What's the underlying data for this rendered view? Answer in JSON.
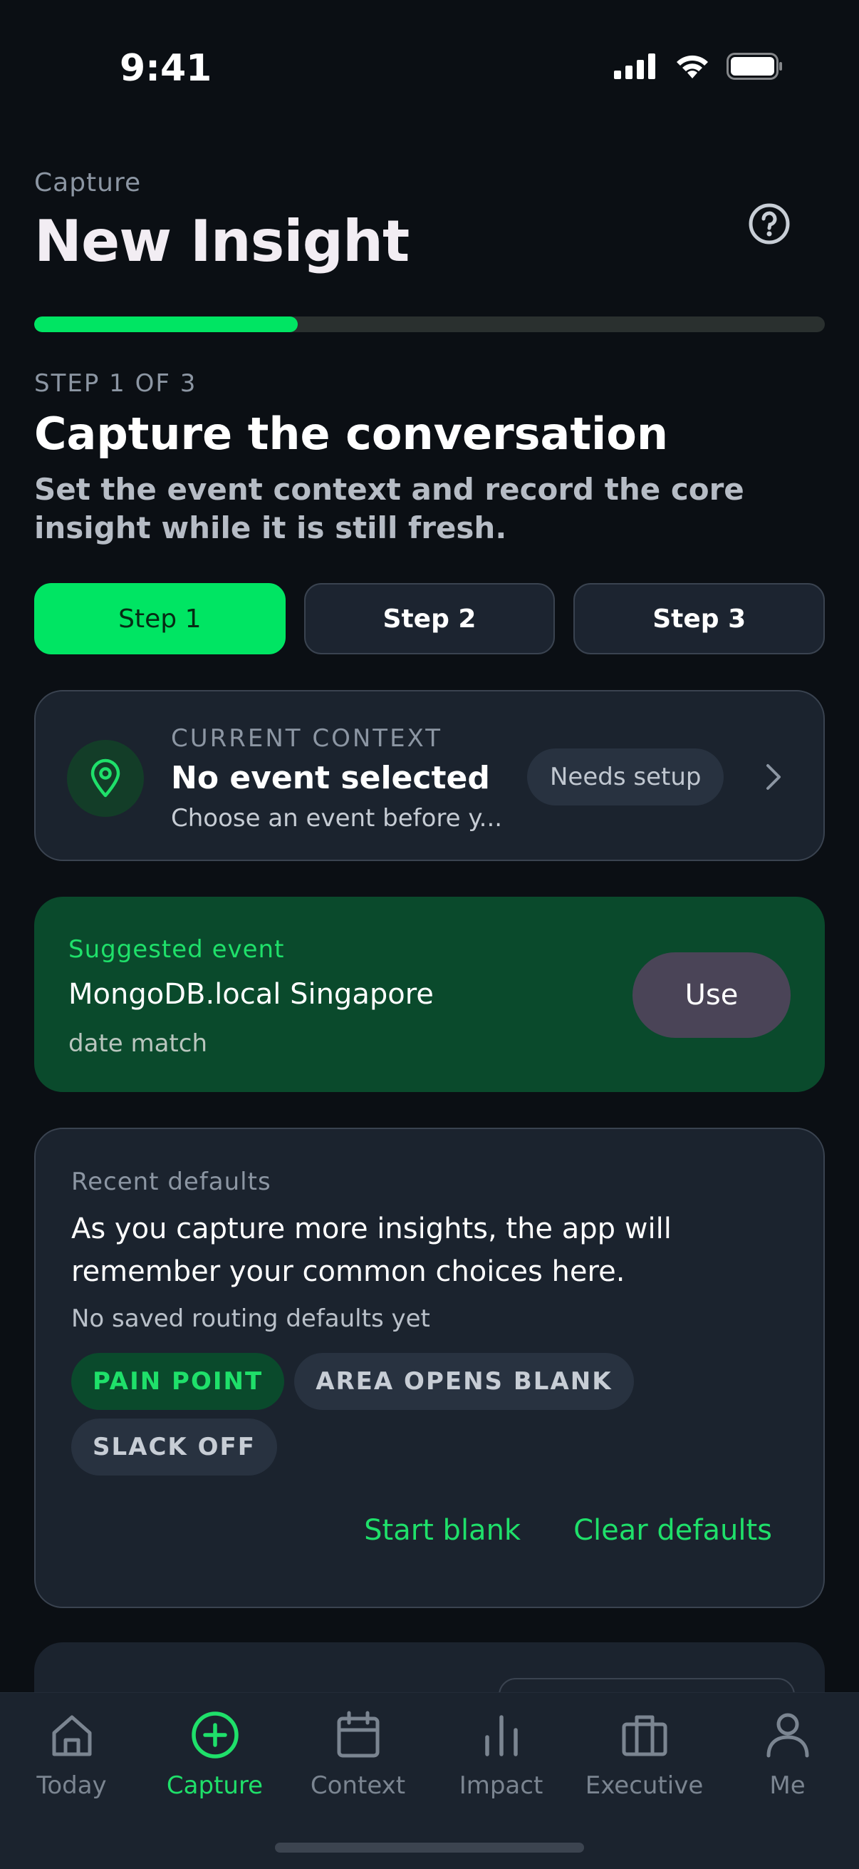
{
  "status_bar": {
    "time": "9:41"
  },
  "header": {
    "eyebrow": "Capture",
    "title": "New Insight"
  },
  "progress": {
    "fraction": 0.333
  },
  "step": {
    "meta": "STEP 1 OF 3",
    "title": "Capture the conversation",
    "description": "Set the event context and record the core insight while it is still fresh."
  },
  "tabs": [
    {
      "label": "Step 1",
      "active": true
    },
    {
      "label": "Step 2",
      "active": false
    },
    {
      "label": "Step 3",
      "active": false
    }
  ],
  "context": {
    "label": "CURRENT CONTEXT",
    "title": "No event selected",
    "subtitle": "Choose an event before y...",
    "badge": "Needs setup"
  },
  "suggested": {
    "label": "Suggested event",
    "name": "MongoDB.local Singapore",
    "meta": "date match",
    "action": "Use"
  },
  "defaults": {
    "label": "Recent defaults",
    "description": "As you capture more insights, the app will remember your common choices here.",
    "empty": "No saved routing defaults yet",
    "chips": [
      {
        "label": "PAIN POINT",
        "tone": "green"
      },
      {
        "label": "AREA OPENS BLANK",
        "tone": "neutral"
      },
      {
        "label": "SLACK OFF",
        "tone": "neutral"
      }
    ],
    "start_blank": "Start blank",
    "clear_defaults": "Clear defaults"
  },
  "tabbar": {
    "items": [
      {
        "label": "Today",
        "icon": "home-icon",
        "active": false
      },
      {
        "label": "Capture",
        "icon": "plus-circle-icon",
        "active": true
      },
      {
        "label": "Context",
        "icon": "calendar-icon",
        "active": false
      },
      {
        "label": "Impact",
        "icon": "bar-chart-icon",
        "active": false
      },
      {
        "label": "Executive",
        "icon": "briefcase-icon",
        "active": false
      },
      {
        "label": "Me",
        "icon": "person-icon",
        "active": false
      }
    ]
  },
  "colors": {
    "accent": "#00e563",
    "background": "#0b0f14",
    "card": "#1b232e",
    "suggest_card": "#0a4a2c"
  }
}
